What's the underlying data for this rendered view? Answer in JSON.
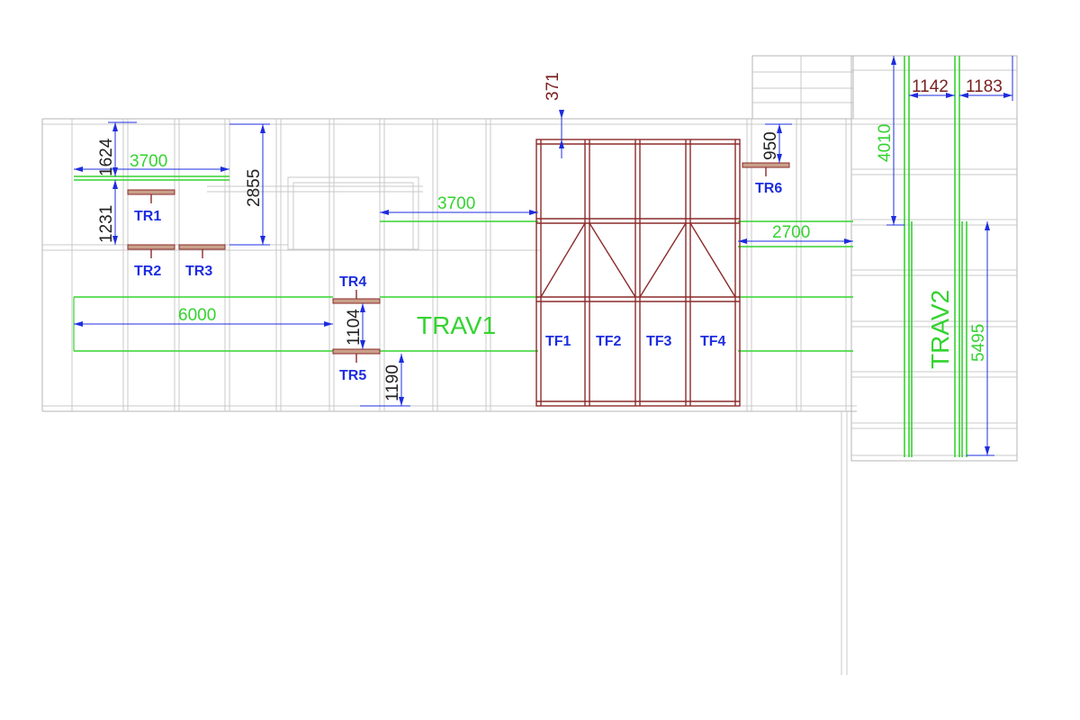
{
  "colors": {
    "beam_green": "#33d42f",
    "frame_maroon": "#8b2a2a",
    "dimension_blue": "#1d2de0",
    "grid_gray": "#c8c8c8"
  },
  "beams": {
    "trav1": "TRAV1",
    "trav2": "TRAV2"
  },
  "truss_frames": {
    "tf1": "TF1",
    "tf2": "TF2",
    "tf3": "TF3",
    "tf4": "TF4"
  },
  "tie_rods": {
    "tr1": "TR1",
    "tr2": "TR2",
    "tr3": "TR3",
    "tr4": "TR4",
    "tr5": "TR5",
    "tr6": "TR6"
  },
  "dimensions": {
    "d1624": "1624",
    "d3700_top": "3700",
    "d1231": "1231",
    "d2855": "2855",
    "d3700_mid": "3700",
    "d371": "371",
    "d950": "950",
    "d2700": "2700",
    "d6000": "6000",
    "d1104": "1104",
    "d1190": "1190",
    "d4010": "4010",
    "d1142": "1142",
    "d1183": "1183",
    "d5495": "5495"
  }
}
